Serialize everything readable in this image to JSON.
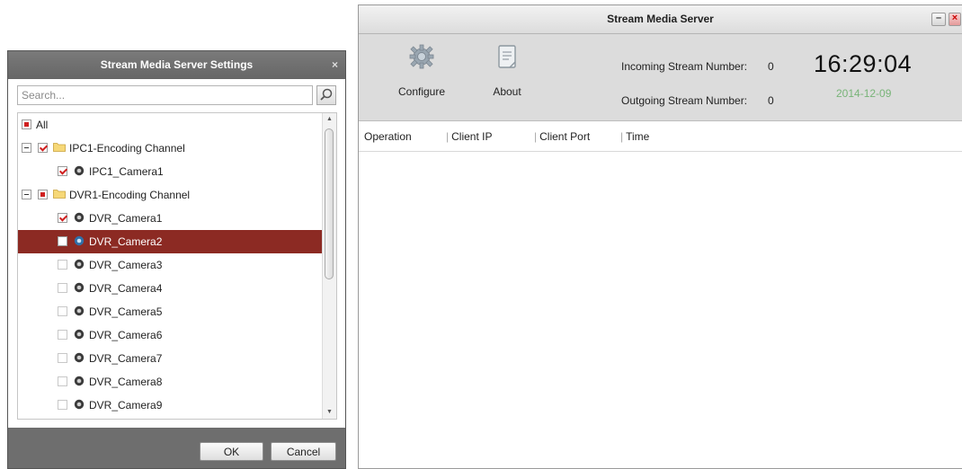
{
  "main": {
    "title": "Stream Media Server",
    "min_label": "–",
    "close_label": "×",
    "toolbar": {
      "configure_label": "Configure",
      "about_label": "About",
      "incoming_label": "Incoming Stream Number:",
      "incoming_value": "0",
      "outgoing_label": "Outgoing Stream Number:",
      "outgoing_value": "0",
      "time": "16:29:04",
      "date": "2014-12-09"
    },
    "table": {
      "columns": [
        "Operation",
        "Client IP",
        "Client Port",
        "Time"
      ]
    }
  },
  "dialog": {
    "title": "Stream Media Server Settings",
    "close_label": "×",
    "search": {
      "placeholder": "Search...",
      "value": ""
    },
    "tree": {
      "all_label": "All",
      "groups": [
        {
          "label": "IPC1-Encoding Channel",
          "state": "checked",
          "children": [
            {
              "label": "IPC1_Camera1",
              "state": "checked"
            }
          ]
        },
        {
          "label": "DVR1-Encoding Channel",
          "state": "partial",
          "children": [
            {
              "label": "DVR_Camera1",
              "state": "checked"
            },
            {
              "label": "DVR_Camera2",
              "state": "unchecked",
              "selected": true
            },
            {
              "label": "DVR_Camera3",
              "state": "unchecked"
            },
            {
              "label": "DVR_Camera4",
              "state": "unchecked"
            },
            {
              "label": "DVR_Camera5",
              "state": "unchecked"
            },
            {
              "label": "DVR_Camera6",
              "state": "unchecked"
            },
            {
              "label": "DVR_Camera7",
              "state": "unchecked"
            },
            {
              "label": "DVR_Camera8",
              "state": "unchecked"
            },
            {
              "label": "DVR_Camera9",
              "state": "unchecked"
            }
          ]
        }
      ]
    },
    "ok_label": "OK",
    "cancel_label": "Cancel"
  },
  "colors": {
    "selection": "#8c2a23",
    "check": "#d02020",
    "date_green": "#78b478",
    "dialog_frame": "#6e6e6e"
  },
  "icons": {
    "configure": "gear-icon",
    "about": "document-icon",
    "search": "magnifier-icon",
    "folder": "folder-icon",
    "camera": "camera-icon"
  }
}
